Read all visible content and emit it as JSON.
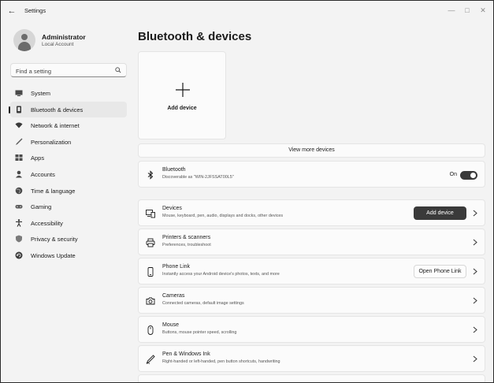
{
  "window": {
    "title": "Settings",
    "back_glyph": "←",
    "min_glyph": "—",
    "max_glyph": "□",
    "close_glyph": "✕"
  },
  "profile": {
    "name": "Administrator",
    "account_type": "Local Account"
  },
  "search": {
    "placeholder": "Find a setting",
    "icon": "search-icon"
  },
  "sidebar": {
    "items": [
      {
        "label": "System",
        "icon": "monitor-icon",
        "active": false
      },
      {
        "label": "Bluetooth & devices",
        "icon": "bluetooth-devices-icon",
        "active": true
      },
      {
        "label": "Network & internet",
        "icon": "wifi-icon",
        "active": false
      },
      {
        "label": "Personalization",
        "icon": "brush-icon",
        "active": false
      },
      {
        "label": "Apps",
        "icon": "apps-icon",
        "active": false
      },
      {
        "label": "Accounts",
        "icon": "person-icon",
        "active": false
      },
      {
        "label": "Time & language",
        "icon": "globe-clock-icon",
        "active": false
      },
      {
        "label": "Gaming",
        "icon": "gamepad-icon",
        "active": false
      },
      {
        "label": "Accessibility",
        "icon": "accessibility-icon",
        "active": false
      },
      {
        "label": "Privacy & security",
        "icon": "shield-icon",
        "active": false
      },
      {
        "label": "Windows Update",
        "icon": "update-icon",
        "active": false
      }
    ]
  },
  "main": {
    "title": "Bluetooth & devices",
    "add_tile_label": "Add device",
    "view_more_label": "View more devices",
    "bluetooth": {
      "title": "Bluetooth",
      "subtitle": "Discoverable as \"WIN-2JFSSAT00L5\"",
      "state_label": "On",
      "toggle_on": true
    },
    "rows": [
      {
        "title": "Devices",
        "subtitle": "Mouse, keyboard, pen, audio, displays and docks, other devices",
        "button": "Add device",
        "icon": "devices-icon"
      },
      {
        "title": "Printers & scanners",
        "subtitle": "Preferences, troubleshoot",
        "icon": "printer-icon"
      },
      {
        "title": "Phone Link",
        "subtitle": "Instantly access your Android device's photos, texts, and more",
        "button": "Open Phone Link",
        "icon": "phone-icon"
      },
      {
        "title": "Cameras",
        "subtitle": "Connected cameras, default image settings",
        "icon": "camera-icon"
      },
      {
        "title": "Mouse",
        "subtitle": "Buttons, mouse pointer speed, scrolling",
        "icon": "mouse-icon"
      },
      {
        "title": "Pen & Windows Ink",
        "subtitle": "Right-handed or left-handed, pen button shortcuts, handwriting",
        "icon": "pen-icon"
      }
    ]
  },
  "colors": {
    "accent_dark": "#3a3a3a",
    "background": "#f3f3f3",
    "card": "#fbfbfb"
  }
}
